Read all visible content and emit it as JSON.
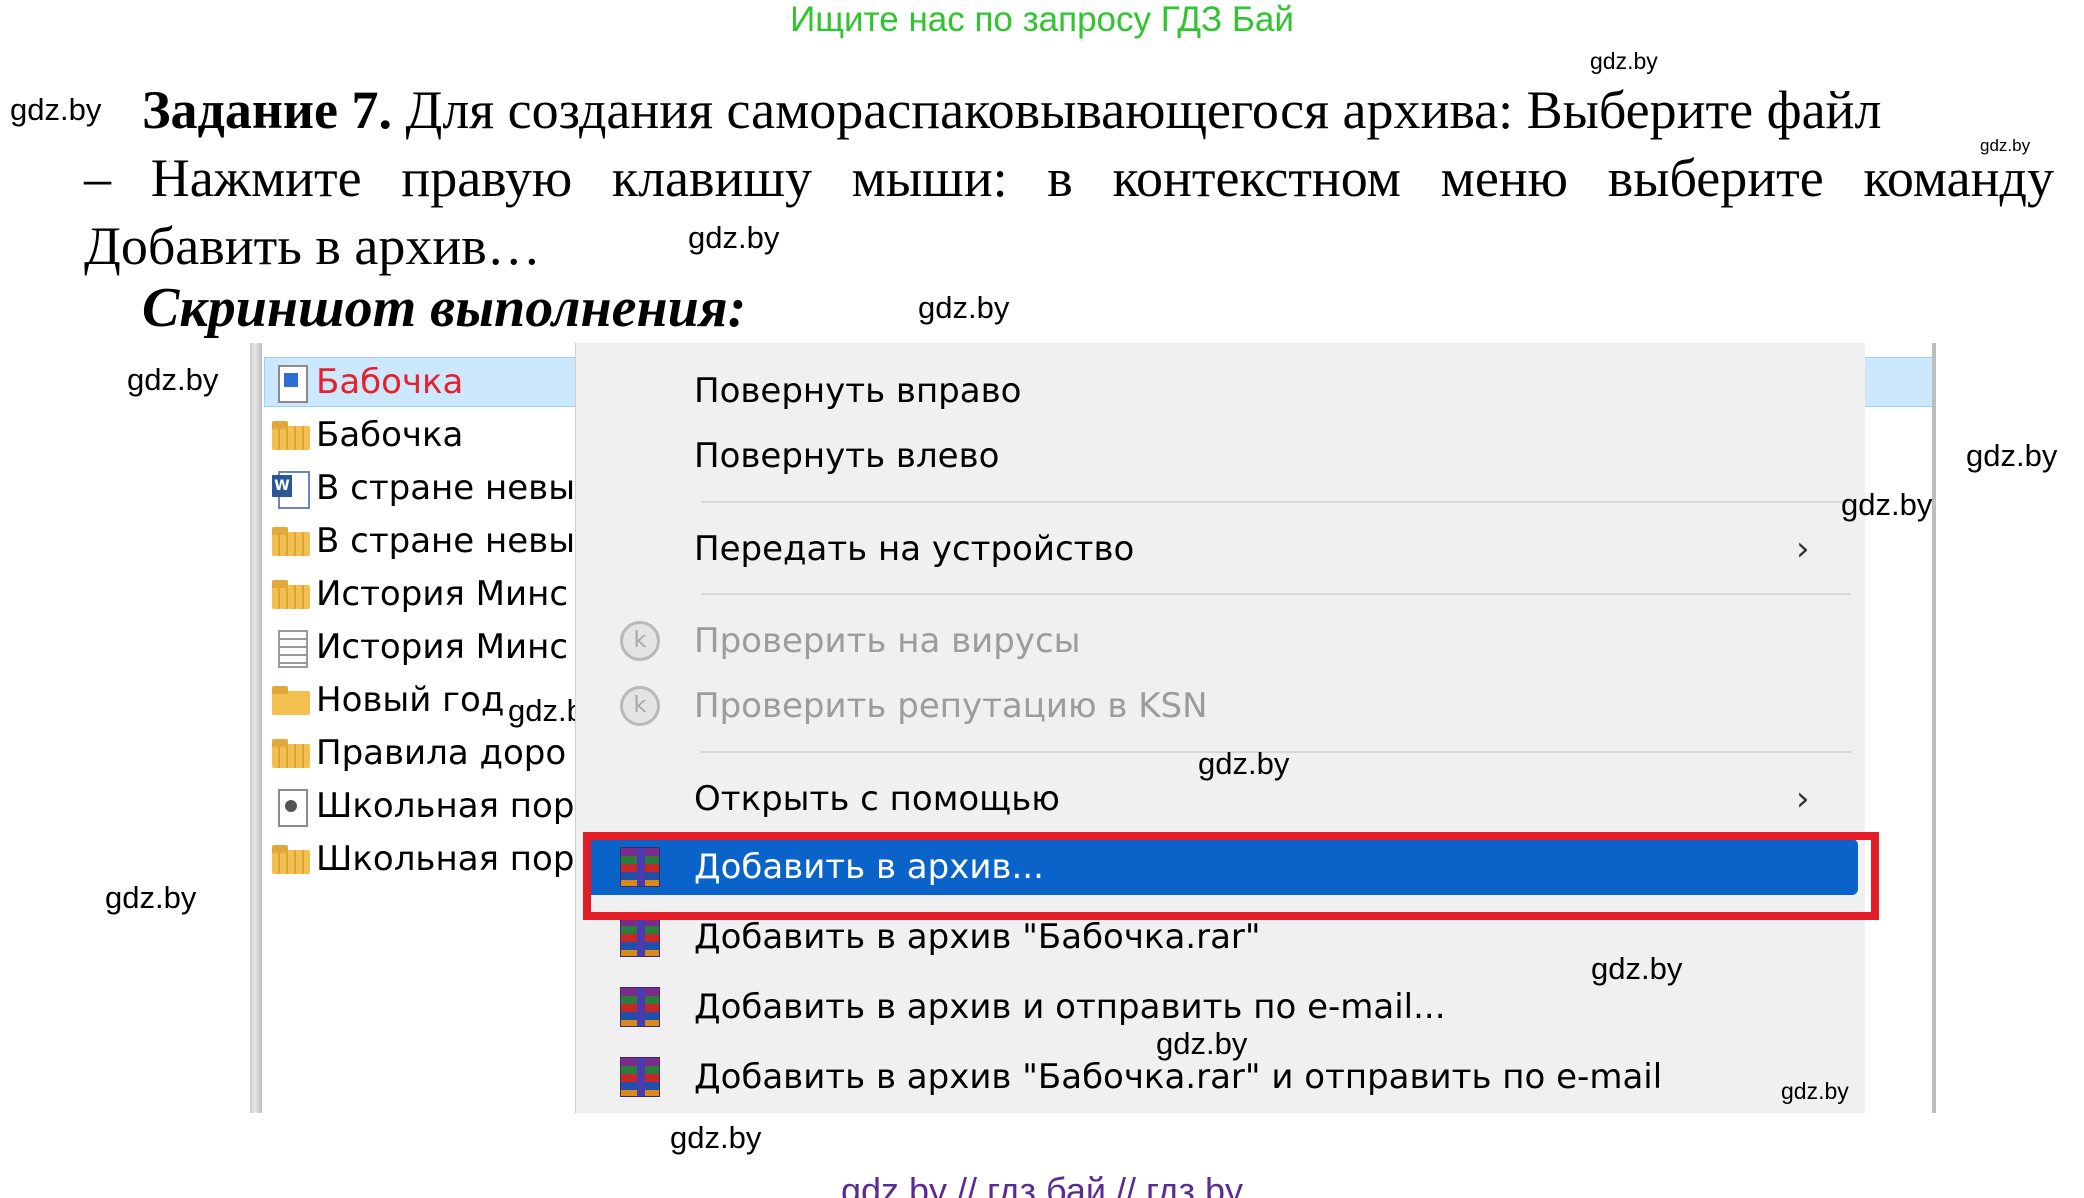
{
  "banner": "Ищите нас по запросу ГДЗ Бай",
  "watermark": "gdz.by",
  "task": {
    "number": "Задание 7.",
    "text_line1": "Для создания самораспаковывающегося архива: Выберите файл",
    "text_line2": "– Нажмите правую клавишу мыши: в контекстном меню выберите команду",
    "text_line3": "Добавить в архив…"
  },
  "subheading": "Скриншот выполнения:",
  "explorer": {
    "files": [
      {
        "name": "Бабочка",
        "icon": "document-icon",
        "selected": true
      },
      {
        "name": "Бабочка",
        "icon": "zip-folder-icon"
      },
      {
        "name": "В стране невы",
        "icon": "word-icon"
      },
      {
        "name": "В стране невы",
        "icon": "zip-folder-icon"
      },
      {
        "name": "История Минс",
        "icon": "zip-folder-icon"
      },
      {
        "name": "История Минс",
        "icon": "text-file-icon"
      },
      {
        "name": "Новый год",
        "icon": "folder-icon"
      },
      {
        "name": "Правила доро",
        "icon": "zip-folder-icon"
      },
      {
        "name": "Школьная пор",
        "icon": "media-file-icon"
      },
      {
        "name": "Школьная пор",
        "icon": "zip-folder-icon"
      }
    ]
  },
  "context_menu": {
    "rotate_right": "Повернуть вправо",
    "rotate_left": "Повернуть влево",
    "cast_to_device": "Передать на устройство",
    "scan_viruses": "Проверить на вирусы",
    "check_ksn": "Проверить репутацию в KSN",
    "open_with": "Открыть с помощью",
    "add_to_archive": "Добавить в архив...",
    "add_to_rar": "Добавить в архив \"Бабочка.rar\"",
    "add_and_email": "Добавить в архив и отправить по e-mail...",
    "add_rar_and_email": "Добавить в архив \"Бабочка.rar\" и отправить по e-mail",
    "submenu_arrow": "›",
    "k_glyph": "k",
    "highlight_color": "#0a63c9",
    "frame_color": "#e31c25"
  },
  "footer": "gdz by  //  гдз бай  //  гдз by"
}
